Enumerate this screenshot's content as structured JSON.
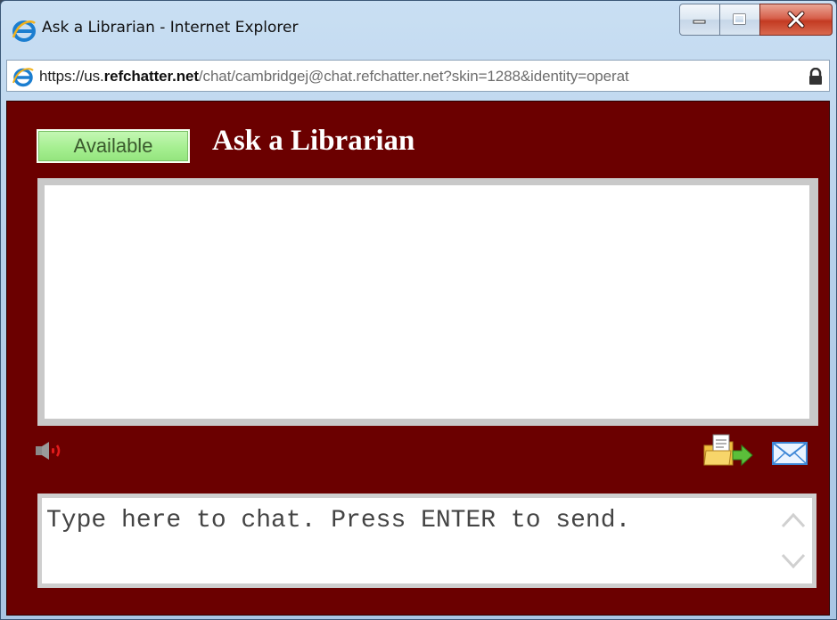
{
  "window": {
    "title": "Ask a Librarian - Internet Explorer",
    "controls": {
      "minimize": "minimize",
      "maximize": "maximize",
      "close": "close"
    }
  },
  "address_bar": {
    "scheme": "https://us.",
    "domain": "refchatter.net",
    "path": "/chat/cambridgej@chat.refchatter.net?skin=1288&identity=operat",
    "icon": "ie-logo-icon",
    "lock_icon": "lock-icon"
  },
  "chat": {
    "status_label": "Available",
    "status_color": "#a6ef91",
    "heading": "Ask a Librarian",
    "background_color": "#6b0000",
    "input_placeholder": "Type here to chat. Press ENTER to send.",
    "icons": [
      "speaker-muted-icon",
      "file-transfer-icon",
      "email-icon"
    ]
  }
}
